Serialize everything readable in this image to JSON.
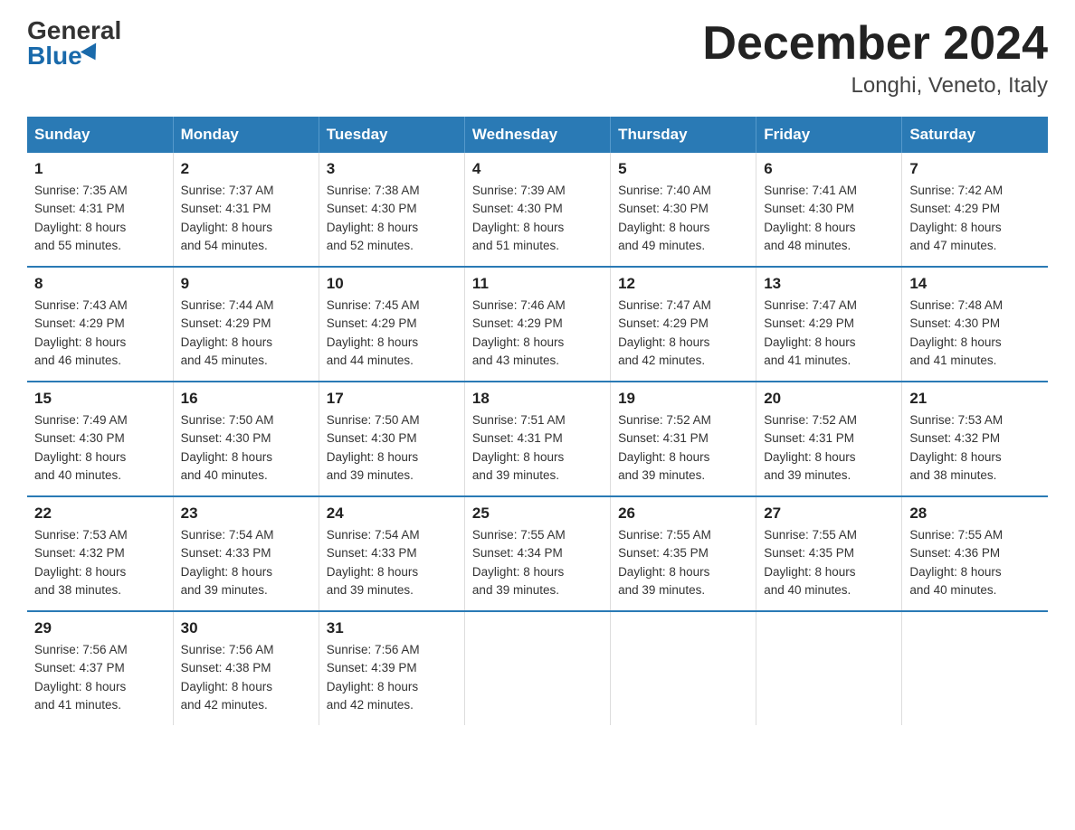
{
  "logo": {
    "general": "General",
    "blue": "Blue"
  },
  "title": "December 2024",
  "subtitle": "Longhi, Veneto, Italy",
  "headers": [
    "Sunday",
    "Monday",
    "Tuesday",
    "Wednesday",
    "Thursday",
    "Friday",
    "Saturday"
  ],
  "weeks": [
    [
      {
        "day": "1",
        "sunrise": "7:35 AM",
        "sunset": "4:31 PM",
        "daylight": "8 hours and 55 minutes."
      },
      {
        "day": "2",
        "sunrise": "7:37 AM",
        "sunset": "4:31 PM",
        "daylight": "8 hours and 54 minutes."
      },
      {
        "day": "3",
        "sunrise": "7:38 AM",
        "sunset": "4:30 PM",
        "daylight": "8 hours and 52 minutes."
      },
      {
        "day": "4",
        "sunrise": "7:39 AM",
        "sunset": "4:30 PM",
        "daylight": "8 hours and 51 minutes."
      },
      {
        "day": "5",
        "sunrise": "7:40 AM",
        "sunset": "4:30 PM",
        "daylight": "8 hours and 49 minutes."
      },
      {
        "day": "6",
        "sunrise": "7:41 AM",
        "sunset": "4:30 PM",
        "daylight": "8 hours and 48 minutes."
      },
      {
        "day": "7",
        "sunrise": "7:42 AM",
        "sunset": "4:29 PM",
        "daylight": "8 hours and 47 minutes."
      }
    ],
    [
      {
        "day": "8",
        "sunrise": "7:43 AM",
        "sunset": "4:29 PM",
        "daylight": "8 hours and 46 minutes."
      },
      {
        "day": "9",
        "sunrise": "7:44 AM",
        "sunset": "4:29 PM",
        "daylight": "8 hours and 45 minutes."
      },
      {
        "day": "10",
        "sunrise": "7:45 AM",
        "sunset": "4:29 PM",
        "daylight": "8 hours and 44 minutes."
      },
      {
        "day": "11",
        "sunrise": "7:46 AM",
        "sunset": "4:29 PM",
        "daylight": "8 hours and 43 minutes."
      },
      {
        "day": "12",
        "sunrise": "7:47 AM",
        "sunset": "4:29 PM",
        "daylight": "8 hours and 42 minutes."
      },
      {
        "day": "13",
        "sunrise": "7:47 AM",
        "sunset": "4:29 PM",
        "daylight": "8 hours and 41 minutes."
      },
      {
        "day": "14",
        "sunrise": "7:48 AM",
        "sunset": "4:30 PM",
        "daylight": "8 hours and 41 minutes."
      }
    ],
    [
      {
        "day": "15",
        "sunrise": "7:49 AM",
        "sunset": "4:30 PM",
        "daylight": "8 hours and 40 minutes."
      },
      {
        "day": "16",
        "sunrise": "7:50 AM",
        "sunset": "4:30 PM",
        "daylight": "8 hours and 40 minutes."
      },
      {
        "day": "17",
        "sunrise": "7:50 AM",
        "sunset": "4:30 PM",
        "daylight": "8 hours and 39 minutes."
      },
      {
        "day": "18",
        "sunrise": "7:51 AM",
        "sunset": "4:31 PM",
        "daylight": "8 hours and 39 minutes."
      },
      {
        "day": "19",
        "sunrise": "7:52 AM",
        "sunset": "4:31 PM",
        "daylight": "8 hours and 39 minutes."
      },
      {
        "day": "20",
        "sunrise": "7:52 AM",
        "sunset": "4:31 PM",
        "daylight": "8 hours and 39 minutes."
      },
      {
        "day": "21",
        "sunrise": "7:53 AM",
        "sunset": "4:32 PM",
        "daylight": "8 hours and 38 minutes."
      }
    ],
    [
      {
        "day": "22",
        "sunrise": "7:53 AM",
        "sunset": "4:32 PM",
        "daylight": "8 hours and 38 minutes."
      },
      {
        "day": "23",
        "sunrise": "7:54 AM",
        "sunset": "4:33 PM",
        "daylight": "8 hours and 39 minutes."
      },
      {
        "day": "24",
        "sunrise": "7:54 AM",
        "sunset": "4:33 PM",
        "daylight": "8 hours and 39 minutes."
      },
      {
        "day": "25",
        "sunrise": "7:55 AM",
        "sunset": "4:34 PM",
        "daylight": "8 hours and 39 minutes."
      },
      {
        "day": "26",
        "sunrise": "7:55 AM",
        "sunset": "4:35 PM",
        "daylight": "8 hours and 39 minutes."
      },
      {
        "day": "27",
        "sunrise": "7:55 AM",
        "sunset": "4:35 PM",
        "daylight": "8 hours and 40 minutes."
      },
      {
        "day": "28",
        "sunrise": "7:55 AM",
        "sunset": "4:36 PM",
        "daylight": "8 hours and 40 minutes."
      }
    ],
    [
      {
        "day": "29",
        "sunrise": "7:56 AM",
        "sunset": "4:37 PM",
        "daylight": "8 hours and 41 minutes."
      },
      {
        "day": "30",
        "sunrise": "7:56 AM",
        "sunset": "4:38 PM",
        "daylight": "8 hours and 42 minutes."
      },
      {
        "day": "31",
        "sunrise": "7:56 AM",
        "sunset": "4:39 PM",
        "daylight": "8 hours and 42 minutes."
      },
      null,
      null,
      null,
      null
    ]
  ],
  "colors": {
    "header_bg": "#2a7ab5",
    "header_text": "#ffffff",
    "border": "#2a7ab5"
  }
}
